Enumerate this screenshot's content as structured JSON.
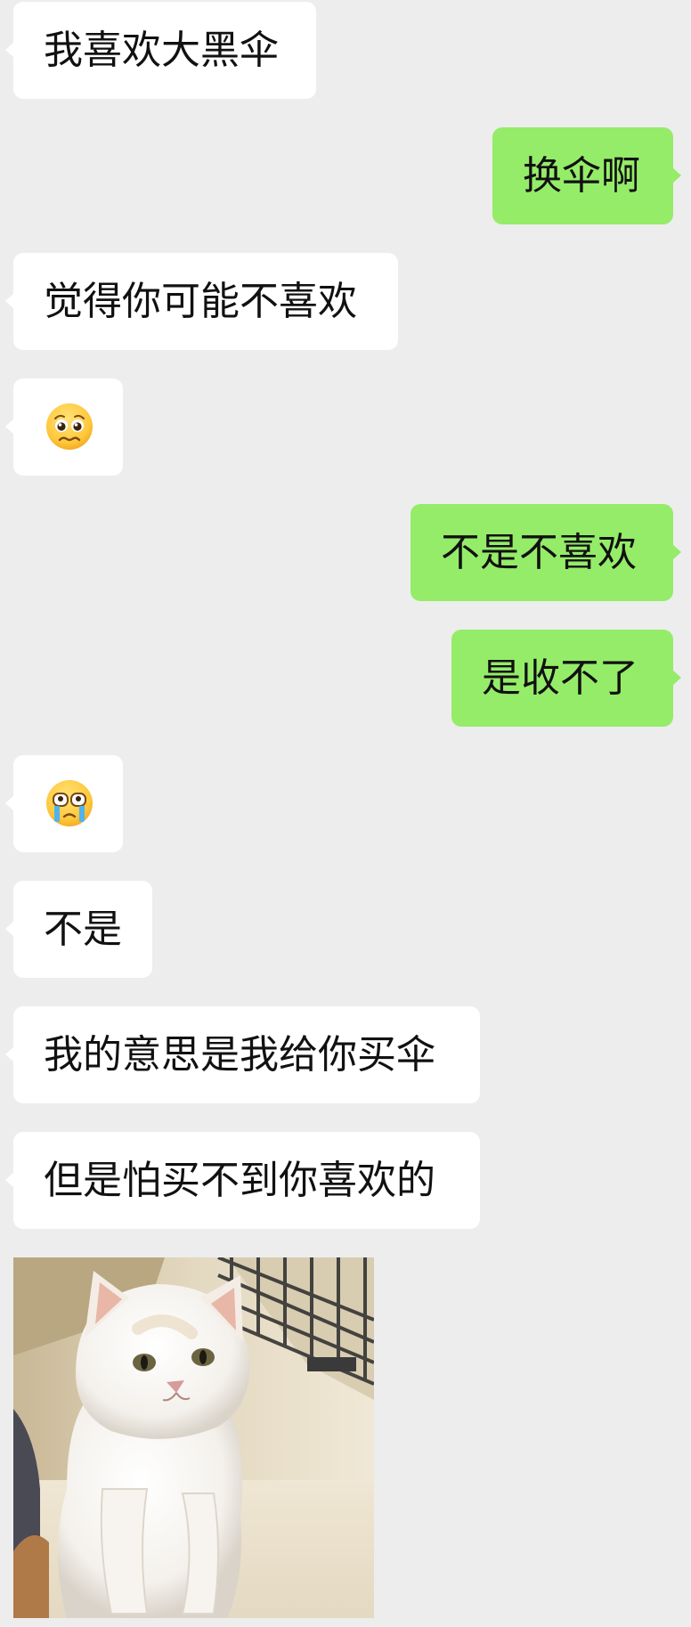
{
  "messages": [
    {
      "side": "in",
      "text": "我喜欢大黑伞"
    },
    {
      "side": "out",
      "text": "换伞啊"
    },
    {
      "side": "in",
      "text": "觉得你可能不喜欢"
    },
    {
      "side": "in",
      "emoji": "pleading-face-icon"
    },
    {
      "side": "out",
      "text": "不是不喜欢"
    },
    {
      "side": "out",
      "text": "是收不了"
    },
    {
      "side": "in",
      "emoji": "crying-face-icon"
    },
    {
      "side": "in",
      "text": "不是"
    },
    {
      "side": "in",
      "text": "我的意思是我给你买伞"
    },
    {
      "side": "in",
      "text": "但是怕买不到你喜欢的"
    },
    {
      "side": "in",
      "image": "white-cat-sticker"
    }
  ],
  "colors": {
    "background": "#ededed",
    "received_bubble": "#ffffff",
    "sent_bubble": "#95ec69",
    "text": "#111111"
  }
}
